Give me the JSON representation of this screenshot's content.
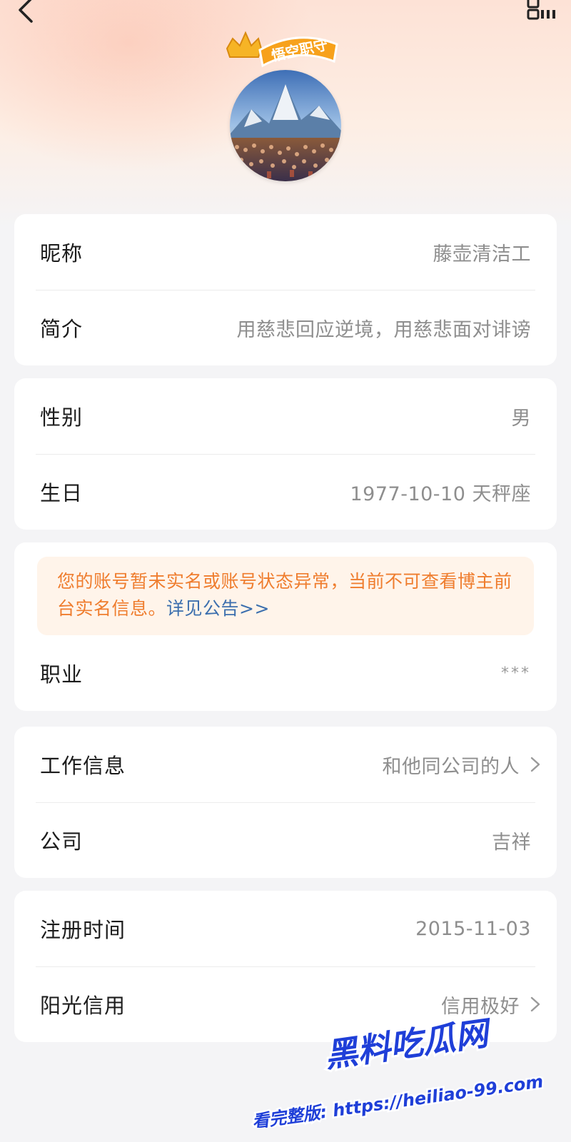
{
  "header": {
    "back_icon": "chevron-left-icon",
    "qr_icon": "qr-code-icon",
    "avatar_badge_text": "悟空职守"
  },
  "sections": [
    {
      "rows": [
        {
          "label": "昵称",
          "value": "藤壶清洁工"
        },
        {
          "label": "简介",
          "value": "用慈悲回应逆境，用慈悲面对诽谤"
        }
      ]
    },
    {
      "rows": [
        {
          "label": "性别",
          "value": "男"
        },
        {
          "label": "生日",
          "value": "1977-10-10 天秤座"
        }
      ]
    },
    {
      "notice": {
        "text": "您的账号暂未实名或账号状态异常，当前不可查看博主前台实名信息。",
        "link": "详见公告>>"
      },
      "rows": [
        {
          "label": "职业",
          "value": "***"
        }
      ]
    },
    {
      "rows": [
        {
          "label": "工作信息",
          "value": "和他同公司的人",
          "chevron": true
        },
        {
          "label": "公司",
          "value": "吉祥"
        }
      ]
    },
    {
      "rows": [
        {
          "label": "注册时间",
          "value": "2015-11-03"
        },
        {
          "label": "阳光信用",
          "value": "信用极好",
          "chevron": true
        }
      ]
    }
  ],
  "watermark": {
    "title": "黑料吃瓜网",
    "subtitle": "看完整版: https://heiliao-99.com"
  },
  "colors": {
    "notice_text": "#ef7d2e",
    "notice_link": "#3c6fae",
    "notice_bg": "#fff4ea",
    "watermark_blue": "#1f3fd8"
  }
}
